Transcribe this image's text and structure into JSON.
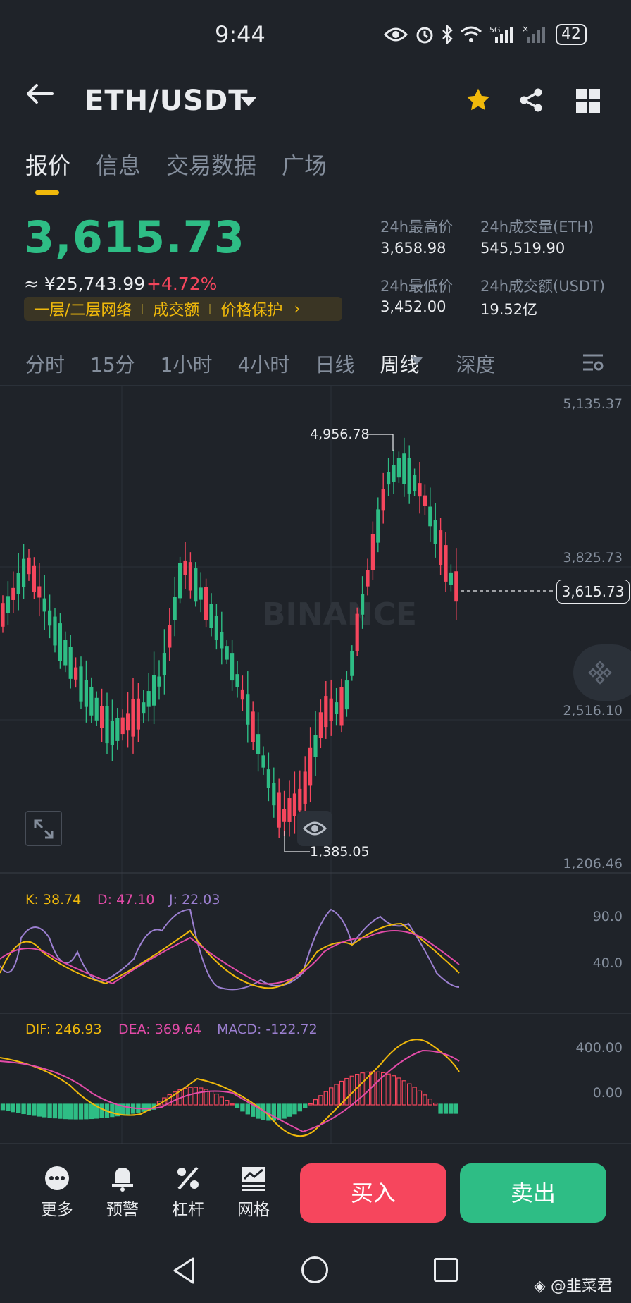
{
  "status_bar": {
    "time": "9:44",
    "battery": "42"
  },
  "header": {
    "pair": "ETH/USDT"
  },
  "tabs": [
    {
      "label": "报价",
      "active": true
    },
    {
      "label": "信息",
      "active": false
    },
    {
      "label": "交易数据",
      "active": false
    },
    {
      "label": "广场",
      "active": false
    }
  ],
  "price": {
    "last": "3,615.73",
    "cny": "≈ ¥25,743.99",
    "change": "+4.72%",
    "tags": [
      "一层/二层网络",
      "成交额",
      "价格保护"
    ],
    "tag_arrow": "›"
  },
  "stats": {
    "high_label": "24h最高价",
    "high": "3,658.98",
    "vol_label": "24h成交量(ETH)",
    "vol": "545,519.90",
    "low_label": "24h最低价",
    "low": "3,452.00",
    "amt_label": "24h成交额(USDT)",
    "amt": "19.52亿"
  },
  "intervals": [
    "分时",
    "15分",
    "1小时",
    "4小时",
    "日线",
    "周线",
    "深度"
  ],
  "chart": {
    "axis": [
      "5,135.37",
      "3,825.73",
      "2,516.10",
      "1,206.46"
    ],
    "current": "3,615.73",
    "high_mark": "4,956.78",
    "low_mark": "1,385.05",
    "watermark": "BINANCE"
  },
  "kdj": {
    "k": "K: 38.74",
    "d": "D: 47.10",
    "j": "J: 22.03",
    "axis": [
      "90.0",
      "40.0"
    ]
  },
  "macd": {
    "dif": "DIF: 246.93",
    "dea": "DEA: 369.64",
    "macd": "MACD: -122.72",
    "axis": [
      "400.00",
      "0.00"
    ]
  },
  "bottom": {
    "more": "更多",
    "alert": "预警",
    "leverage": "杠杆",
    "grid": "网格",
    "buy": "买入",
    "sell": "卖出"
  },
  "credit": "@韭菜君",
  "colors": {
    "up": "#2ebd85",
    "down": "#f6465d",
    "accent": "#f0b90b",
    "bg": "#1f2329"
  },
  "chart_data": {
    "type": "candlestick",
    "ylim": [
      1206.46,
      5135.37
    ],
    "candles": []
  }
}
